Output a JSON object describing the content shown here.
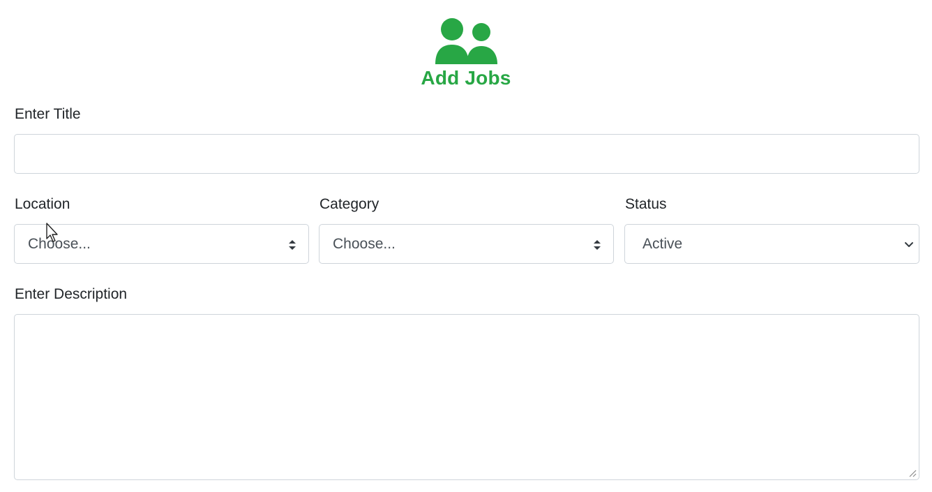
{
  "header": {
    "icon": "users-icon",
    "title": "Add Jobs",
    "accent_color": "#28a745"
  },
  "form": {
    "title_label": "Enter Title",
    "title_value": "",
    "location": {
      "label": "Location",
      "selected": "Choose...",
      "icon": "sort-arrows-icon"
    },
    "category": {
      "label": "Category",
      "selected": "Choose...",
      "icon": "sort-arrows-icon"
    },
    "status": {
      "label": "Status",
      "selected": "Active",
      "icon": "chevron-down-icon"
    },
    "description_label": "Enter Description",
    "description_value": ""
  }
}
